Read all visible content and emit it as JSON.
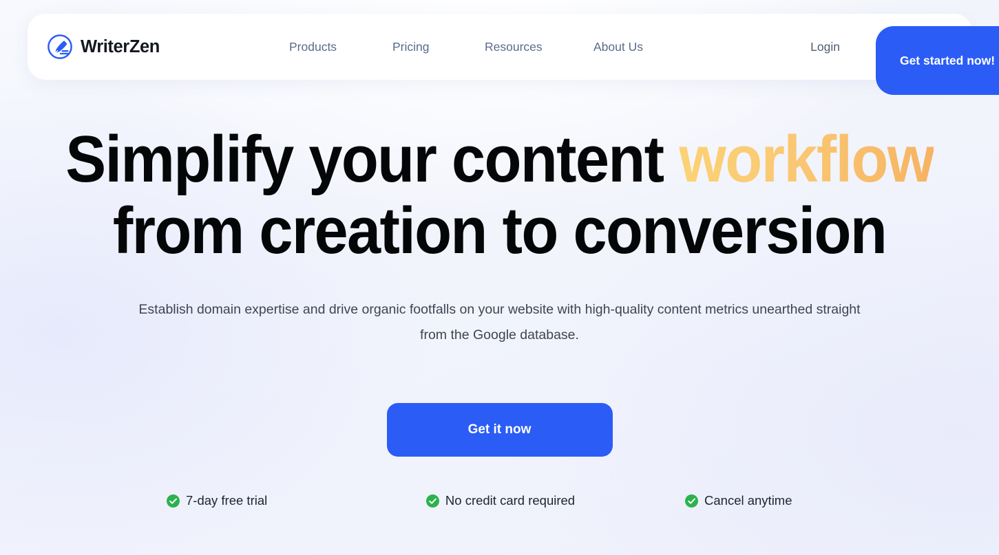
{
  "brand": {
    "name": "WriterZen",
    "logo_icon": "writerzen-pen-circle-logo",
    "accent_blue": "#2B5CF6"
  },
  "nav": {
    "links": [
      {
        "label": "Products"
      },
      {
        "label": "Pricing"
      },
      {
        "label": "Resources"
      },
      {
        "label": "About Us"
      }
    ],
    "login_label": "Login",
    "cta_label": "Get started now!"
  },
  "hero": {
    "heading_part1": "Simplify your content ",
    "heading_highlight": "workflow",
    "heading_part2": " from creation to conversion",
    "highlight_color_start": "#FBD375",
    "highlight_color_end": "#F6B362",
    "subtitle": "Establish domain expertise and drive organic footfalls on your website with high-quality content metrics unearthed straight from the Google database.",
    "cta_label": "Get it now"
  },
  "trust_badges": {
    "check_color": "#2BB24C",
    "items": [
      {
        "icon": "check-circle-icon",
        "label": "7-day free trial"
      },
      {
        "icon": "check-circle-icon",
        "label": "No credit card required"
      },
      {
        "icon": "check-circle-icon",
        "label": "Cancel anytime"
      }
    ]
  }
}
